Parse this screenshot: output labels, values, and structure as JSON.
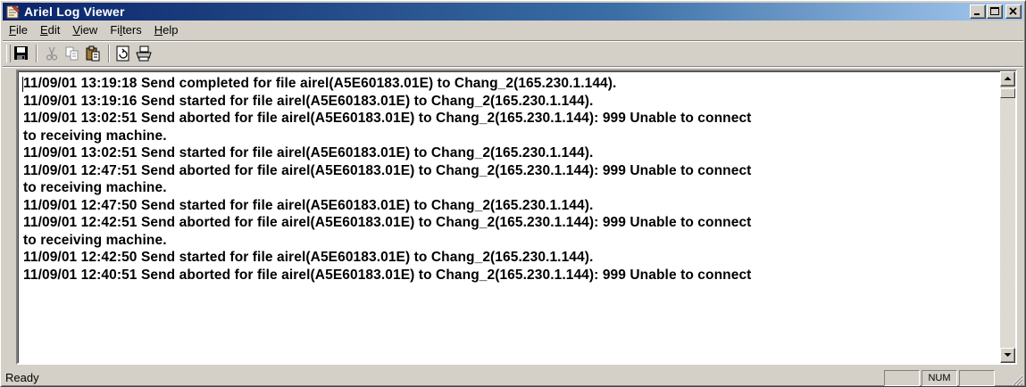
{
  "window": {
    "title": "Ariel Log Viewer"
  },
  "menu": {
    "items": [
      {
        "key": "F",
        "rest": "ile"
      },
      {
        "key": "E",
        "rest": "dit"
      },
      {
        "key": "V",
        "rest": "iew"
      },
      {
        "pre": "Fi",
        "key": "l",
        "rest": "ters"
      },
      {
        "key": "H",
        "rest": "elp"
      }
    ]
  },
  "toolbar": {
    "icons": [
      "save-icon",
      "cut-icon",
      "copy-icon",
      "paste-icon",
      "refresh-icon",
      "print-icon"
    ]
  },
  "log": {
    "lines": [
      "11/09/01 13:19:18  Send completed for file airel(A5E60183.01E) to Chang_2(165.230.1.144).",
      "11/09/01 13:19:16  Send started for file airel(A5E60183.01E) to Chang_2(165.230.1.144).",
      "11/09/01 13:02:51  Send aborted for file airel(A5E60183.01E) to Chang_2(165.230.1.144): 999 Unable to connect",
      "to receiving machine.",
      "11/09/01 13:02:51  Send started for file airel(A5E60183.01E) to Chang_2(165.230.1.144).",
      "11/09/01 12:47:51  Send aborted for file airel(A5E60183.01E) to Chang_2(165.230.1.144): 999 Unable to connect",
      "to receiving machine.",
      "11/09/01 12:47:50  Send started for file airel(A5E60183.01E) to Chang_2(165.230.1.144).",
      "11/09/01 12:42:51  Send aborted for file airel(A5E60183.01E) to Chang_2(165.230.1.144): 999 Unable to connect",
      "to receiving machine.",
      "11/09/01 12:42:50  Send started for file airel(A5E60183.01E) to Chang_2(165.230.1.144).",
      "11/09/01 12:40:51  Send aborted for file airel(A5E60183.01E) to Chang_2(165.230.1.144): 999 Unable to connect"
    ]
  },
  "statusbar": {
    "text": "Ready",
    "panel_1": "",
    "panel_2": "NUM",
    "panel_3": ""
  },
  "colors": {
    "title_active_start": "#0a246a",
    "title_active_end": "#a6caf0",
    "face": "#d4d0c8"
  }
}
